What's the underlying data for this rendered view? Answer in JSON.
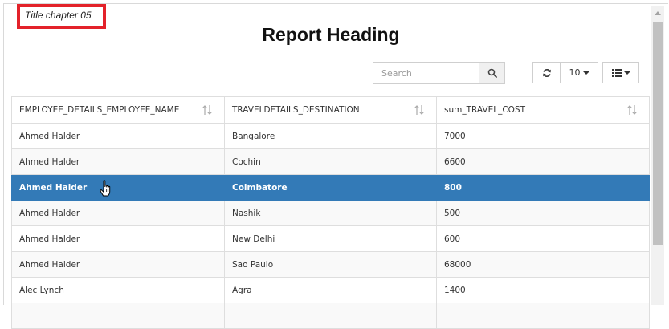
{
  "chapter_title": "Title chapter 05",
  "report_heading": "Report Heading",
  "search": {
    "placeholder": "Search"
  },
  "toolbar": {
    "page_size": "10"
  },
  "table": {
    "columns": [
      "EMPLOYEE_DETAILS_EMPLOYEE_NAME",
      "TRAVELDETAILS_DESTINATION",
      "sum_TRAVEL_COST"
    ],
    "rows": [
      [
        "Ahmed Halder",
        "Bangalore",
        "7000"
      ],
      [
        "Ahmed Halder",
        "Cochin",
        "6600"
      ],
      [
        "Ahmed Halder",
        "Coimbatore",
        "800"
      ],
      [
        "Ahmed Halder",
        "Nashik",
        "500"
      ],
      [
        "Ahmed Halder",
        "New Delhi",
        "600"
      ],
      [
        "Ahmed Halder",
        "Sao Paulo",
        "68000"
      ],
      [
        "Alec Lynch",
        "Agra",
        "1400"
      ],
      [
        "",
        "",
        ""
      ]
    ],
    "selected_row": 2
  },
  "colors": {
    "selected_row": "#337ab7",
    "chapter_border": "#e3222a"
  },
  "icons": {
    "search": "search-icon",
    "refresh": "refresh-icon",
    "columns": "list-icon",
    "sort": "sort-icon",
    "cursor": "hand-cursor-icon"
  }
}
